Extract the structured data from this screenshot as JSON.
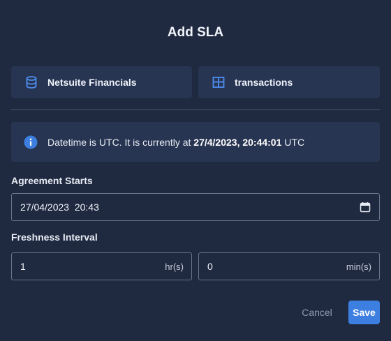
{
  "dialog": {
    "title": "Add SLA"
  },
  "sources": {
    "database": {
      "label": "Netsuite Financials",
      "icon": "database-icon"
    },
    "table": {
      "label": "transactions",
      "icon": "table-icon"
    }
  },
  "info": {
    "icon": "info-icon",
    "prefix": "Datetime is UTC. It is currently at ",
    "current_time": "27/4/2023, 20:44:01",
    "suffix": " UTC"
  },
  "agreement": {
    "label": "Agreement Starts",
    "value": "27/04/2023  20:43",
    "icon": "calendar-icon"
  },
  "freshness": {
    "label": "Freshness Interval",
    "hours": {
      "value": "1",
      "unit": "hr(s)"
    },
    "minutes": {
      "value": "0",
      "unit": "min(s)"
    }
  },
  "actions": {
    "cancel_label": "Cancel",
    "save_label": "Save"
  },
  "colors": {
    "background": "#1f2940",
    "card": "#283552",
    "accent": "#3d7fe0"
  }
}
